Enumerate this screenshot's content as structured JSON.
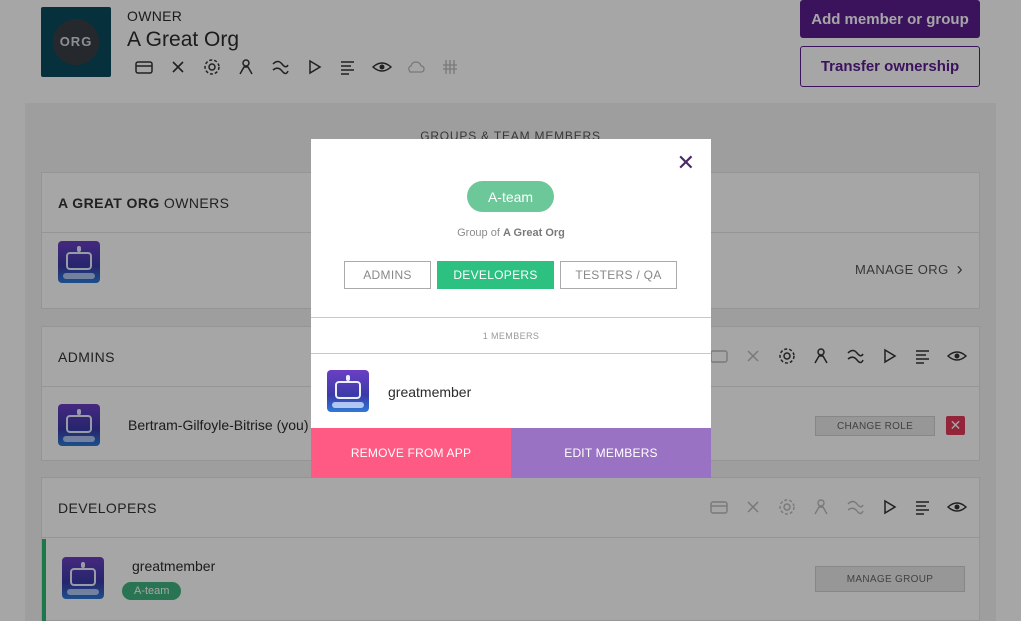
{
  "header": {
    "owner_label": "OWNER",
    "org_name": "A Great Org",
    "logo_text": "ORG",
    "add_member_label": "Add member or group",
    "transfer_label": "Transfer ownership",
    "icons": [
      "card-icon",
      "close-x-icon",
      "gear-icon",
      "person-icon",
      "route-icon",
      "play-icon",
      "list-icon",
      "eye-icon",
      "cloud-icon",
      "hash-icon"
    ]
  },
  "section_title": "GROUPS & TEAM MEMBERS",
  "owners_card": {
    "title_bold": "A GREAT ORG",
    "title_rest": " OWNERS",
    "manage_label": "MANAGE ORG"
  },
  "admins_card": {
    "title": "ADMINS",
    "member_name": "Bertram-Gilfoyle-Bitrise (you)",
    "change_role_label": "CHANGE ROLE",
    "delete_label": "✕"
  },
  "developers_card": {
    "title": "DEVELOPERS",
    "member_name": "greatmember",
    "badge": "A-team",
    "manage_group_label": "MANAGE GROUP"
  },
  "modal": {
    "close_label": "✕",
    "team_name": "A-team",
    "group_of_prefix": "Group of ",
    "group_of_org": "A Great Org",
    "tabs": [
      {
        "label": "ADMINS",
        "active": false
      },
      {
        "label": "DEVELOPERS",
        "active": true
      },
      {
        "label": "TESTERS / QA",
        "active": false
      }
    ],
    "members_count": "1 MEMBERS",
    "member_name": "greatmember",
    "remove_label": "REMOVE FROM APP",
    "edit_label": "EDIT MEMBERS"
  },
  "colors": {
    "primary_purple": "#5b1e8f",
    "green": "#2cc181",
    "pink": "#ff5a84",
    "lavender": "#9a72c3"
  }
}
